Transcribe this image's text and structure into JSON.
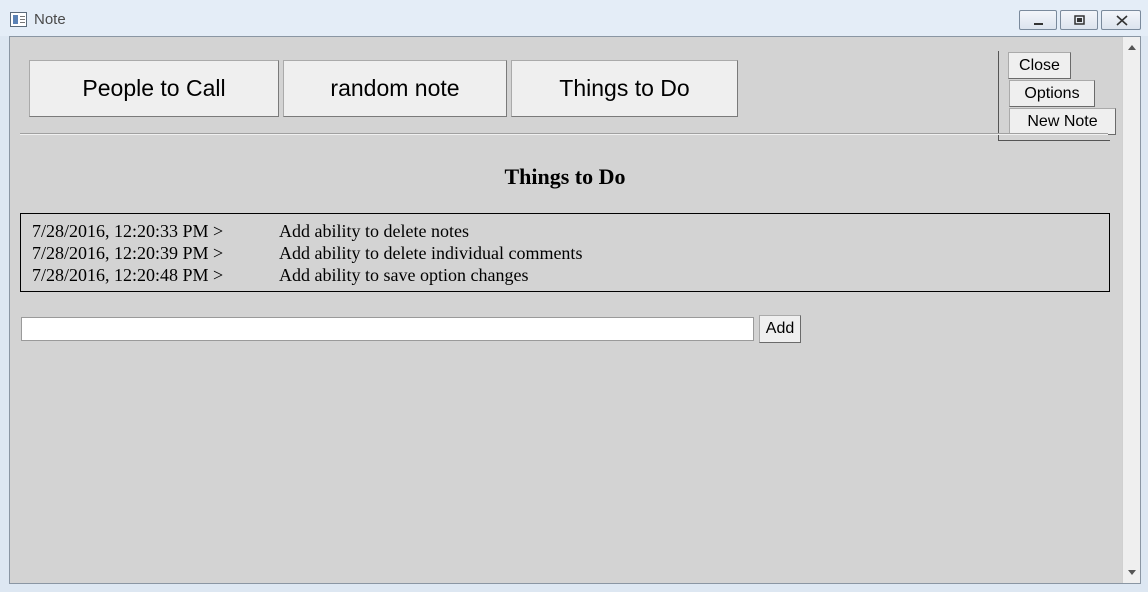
{
  "window": {
    "title": "Note",
    "controls": [
      "minimize-icon",
      "maximize-icon",
      "close-icon"
    ]
  },
  "tabs": [
    {
      "label": "People to Call"
    },
    {
      "label": "random note"
    },
    {
      "label": "Things to Do"
    }
  ],
  "sidebar": {
    "close_label": "Close",
    "options_label": "Options",
    "new_note_label": "New Note"
  },
  "note": {
    "title": "Things to Do",
    "comments": [
      {
        "timestamp": "7/28/2016, 12:20:33 PM >",
        "text": "Add ability to delete notes"
      },
      {
        "timestamp": "7/28/2016, 12:20:39 PM >",
        "text": "Add ability to delete individual comments"
      },
      {
        "timestamp": "7/28/2016, 12:20:48 PM >",
        "text": "Add ability to save option changes"
      }
    ]
  },
  "input": {
    "value": "",
    "placeholder": ""
  },
  "add_label": "Add"
}
